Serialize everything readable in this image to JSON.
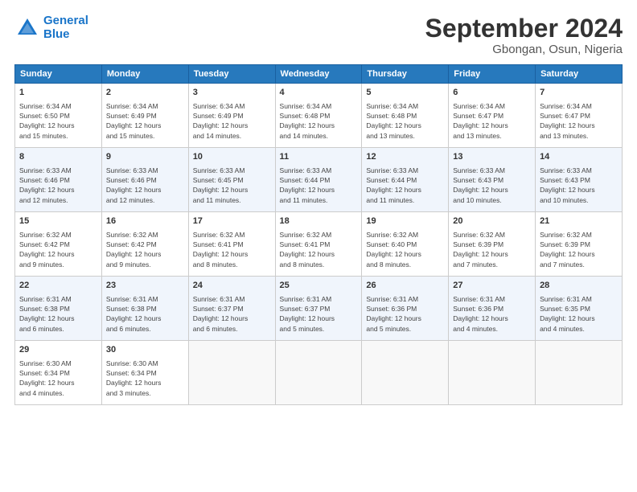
{
  "header": {
    "logo_line1": "General",
    "logo_line2": "Blue",
    "month_title": "September 2024",
    "location": "Gbongan, Osun, Nigeria"
  },
  "days_of_week": [
    "Sunday",
    "Monday",
    "Tuesday",
    "Wednesday",
    "Thursday",
    "Friday",
    "Saturday"
  ],
  "weeks": [
    [
      {
        "day": "1",
        "detail": "Sunrise: 6:34 AM\nSunset: 6:50 PM\nDaylight: 12 hours\nand 15 minutes."
      },
      {
        "day": "2",
        "detail": "Sunrise: 6:34 AM\nSunset: 6:49 PM\nDaylight: 12 hours\nand 15 minutes."
      },
      {
        "day": "3",
        "detail": "Sunrise: 6:34 AM\nSunset: 6:49 PM\nDaylight: 12 hours\nand 14 minutes."
      },
      {
        "day": "4",
        "detail": "Sunrise: 6:34 AM\nSunset: 6:48 PM\nDaylight: 12 hours\nand 14 minutes."
      },
      {
        "day": "5",
        "detail": "Sunrise: 6:34 AM\nSunset: 6:48 PM\nDaylight: 12 hours\nand 13 minutes."
      },
      {
        "day": "6",
        "detail": "Sunrise: 6:34 AM\nSunset: 6:47 PM\nDaylight: 12 hours\nand 13 minutes."
      },
      {
        "day": "7",
        "detail": "Sunrise: 6:34 AM\nSunset: 6:47 PM\nDaylight: 12 hours\nand 13 minutes."
      }
    ],
    [
      {
        "day": "8",
        "detail": "Sunrise: 6:33 AM\nSunset: 6:46 PM\nDaylight: 12 hours\nand 12 minutes."
      },
      {
        "day": "9",
        "detail": "Sunrise: 6:33 AM\nSunset: 6:46 PM\nDaylight: 12 hours\nand 12 minutes."
      },
      {
        "day": "10",
        "detail": "Sunrise: 6:33 AM\nSunset: 6:45 PM\nDaylight: 12 hours\nand 11 minutes."
      },
      {
        "day": "11",
        "detail": "Sunrise: 6:33 AM\nSunset: 6:44 PM\nDaylight: 12 hours\nand 11 minutes."
      },
      {
        "day": "12",
        "detail": "Sunrise: 6:33 AM\nSunset: 6:44 PM\nDaylight: 12 hours\nand 11 minutes."
      },
      {
        "day": "13",
        "detail": "Sunrise: 6:33 AM\nSunset: 6:43 PM\nDaylight: 12 hours\nand 10 minutes."
      },
      {
        "day": "14",
        "detail": "Sunrise: 6:33 AM\nSunset: 6:43 PM\nDaylight: 12 hours\nand 10 minutes."
      }
    ],
    [
      {
        "day": "15",
        "detail": "Sunrise: 6:32 AM\nSunset: 6:42 PM\nDaylight: 12 hours\nand 9 minutes."
      },
      {
        "day": "16",
        "detail": "Sunrise: 6:32 AM\nSunset: 6:42 PM\nDaylight: 12 hours\nand 9 minutes."
      },
      {
        "day": "17",
        "detail": "Sunrise: 6:32 AM\nSunset: 6:41 PM\nDaylight: 12 hours\nand 8 minutes."
      },
      {
        "day": "18",
        "detail": "Sunrise: 6:32 AM\nSunset: 6:41 PM\nDaylight: 12 hours\nand 8 minutes."
      },
      {
        "day": "19",
        "detail": "Sunrise: 6:32 AM\nSunset: 6:40 PM\nDaylight: 12 hours\nand 8 minutes."
      },
      {
        "day": "20",
        "detail": "Sunrise: 6:32 AM\nSunset: 6:39 PM\nDaylight: 12 hours\nand 7 minutes."
      },
      {
        "day": "21",
        "detail": "Sunrise: 6:32 AM\nSunset: 6:39 PM\nDaylight: 12 hours\nand 7 minutes."
      }
    ],
    [
      {
        "day": "22",
        "detail": "Sunrise: 6:31 AM\nSunset: 6:38 PM\nDaylight: 12 hours\nand 6 minutes."
      },
      {
        "day": "23",
        "detail": "Sunrise: 6:31 AM\nSunset: 6:38 PM\nDaylight: 12 hours\nand 6 minutes."
      },
      {
        "day": "24",
        "detail": "Sunrise: 6:31 AM\nSunset: 6:37 PM\nDaylight: 12 hours\nand 6 minutes."
      },
      {
        "day": "25",
        "detail": "Sunrise: 6:31 AM\nSunset: 6:37 PM\nDaylight: 12 hours\nand 5 minutes."
      },
      {
        "day": "26",
        "detail": "Sunrise: 6:31 AM\nSunset: 6:36 PM\nDaylight: 12 hours\nand 5 minutes."
      },
      {
        "day": "27",
        "detail": "Sunrise: 6:31 AM\nSunset: 6:36 PM\nDaylight: 12 hours\nand 4 minutes."
      },
      {
        "day": "28",
        "detail": "Sunrise: 6:31 AM\nSunset: 6:35 PM\nDaylight: 12 hours\nand 4 minutes."
      }
    ],
    [
      {
        "day": "29",
        "detail": "Sunrise: 6:30 AM\nSunset: 6:34 PM\nDaylight: 12 hours\nand 4 minutes."
      },
      {
        "day": "30",
        "detail": "Sunrise: 6:30 AM\nSunset: 6:34 PM\nDaylight: 12 hours\nand 3 minutes."
      },
      {
        "day": "",
        "detail": ""
      },
      {
        "day": "",
        "detail": ""
      },
      {
        "day": "",
        "detail": ""
      },
      {
        "day": "",
        "detail": ""
      },
      {
        "day": "",
        "detail": ""
      }
    ]
  ]
}
